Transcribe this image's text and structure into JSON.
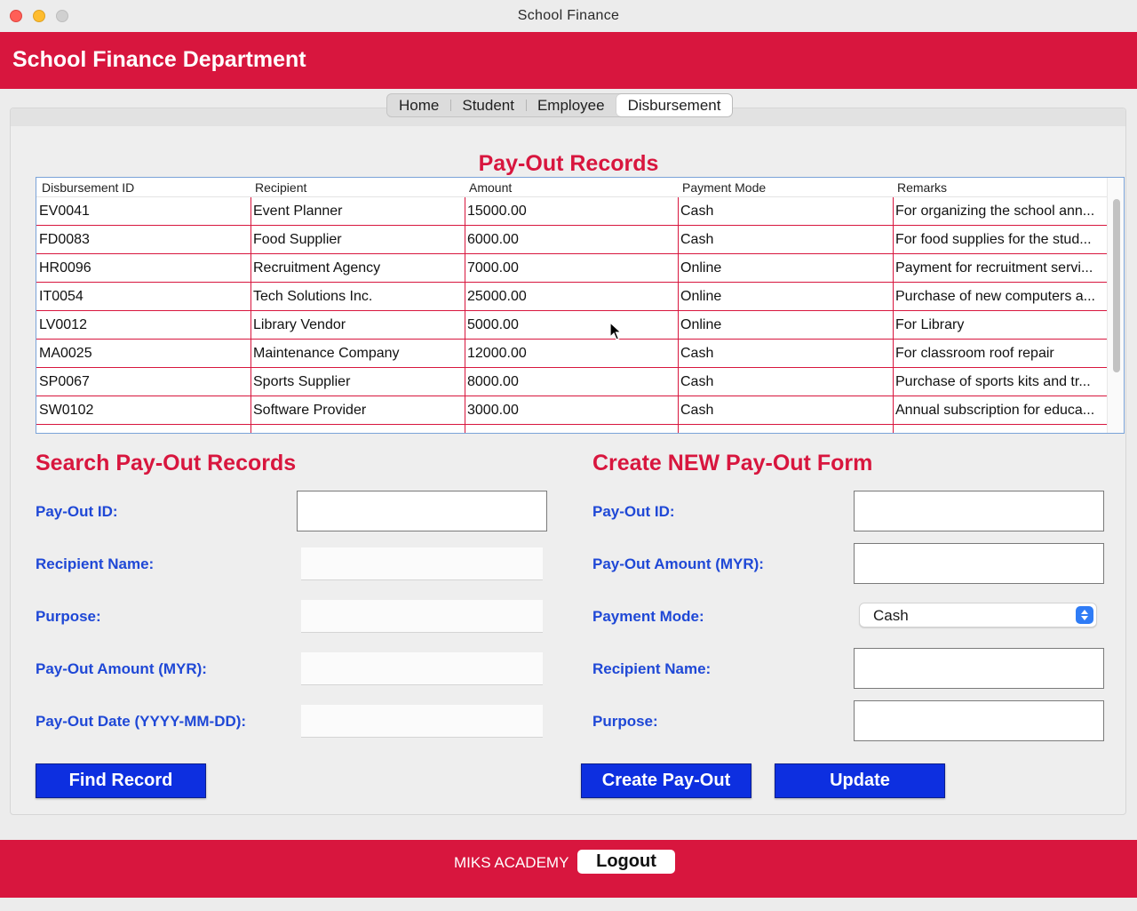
{
  "window": {
    "title": "School Finance"
  },
  "header": {
    "title": "School Finance Department"
  },
  "tabs": [
    {
      "label": "Home"
    },
    {
      "label": "Student"
    },
    {
      "label": "Employee"
    },
    {
      "label": "Disbursement",
      "active": true
    }
  ],
  "records": {
    "title": "Pay-Out Records",
    "columns": [
      "Disbursement ID",
      "Recipient",
      "Amount",
      "Payment Mode",
      "Remarks"
    ],
    "rows": [
      [
        "EV0041",
        "Event Planner",
        "15000.00",
        "Cash",
        "For organizing the school ann..."
      ],
      [
        "FD0083",
        "Food Supplier",
        "6000.00",
        "Cash",
        "For food supplies for the stud..."
      ],
      [
        "HR0096",
        "Recruitment Agency",
        "7000.00",
        "Online",
        "Payment for recruitment servi..."
      ],
      [
        "IT0054",
        "Tech Solutions Inc.",
        "25000.00",
        "Online",
        "Purchase of new computers a..."
      ],
      [
        "LV0012",
        "Library Vendor",
        "5000.00",
        "Online",
        "For Library"
      ],
      [
        "MA0025",
        "Maintenance Company",
        "12000.00",
        "Cash",
        "For classroom roof repair"
      ],
      [
        "SP0067",
        "Sports Supplier",
        "8000.00",
        "Cash",
        "Purchase of sports kits and tr..."
      ],
      [
        "SW0102",
        "Software Provider",
        "3000.00",
        "Cash",
        "Annual subscription for educa..."
      ]
    ]
  },
  "search": {
    "title": "Search Pay-Out Records",
    "payout_id_label": "Pay-Out ID:",
    "recipient_label": "Recipient Name:",
    "purpose_label": "Purpose:",
    "amount_label": "Pay-Out Amount (MYR):",
    "date_label": "Pay-Out Date (YYYY-MM-DD):",
    "payout_id_value": "",
    "recipient_value": "",
    "purpose_value": "",
    "amount_value": "",
    "date_value": "",
    "find_button": "Find Record"
  },
  "create": {
    "title": "Create NEW Pay-Out Form",
    "payout_id_label": "Pay-Out ID:",
    "amount_label": "Pay-Out Amount (MYR):",
    "mode_label": "Payment Mode:",
    "mode_value": "Cash",
    "recipient_label": "Recipient Name:",
    "purpose_label": "Purpose:",
    "payout_id_value": "",
    "amount_value": "",
    "recipient_value": "",
    "purpose_value": "",
    "create_button": "Create Pay-Out",
    "update_button": "Update"
  },
  "footer": {
    "academy": "MIKS ACADEMY",
    "logout": "Logout"
  },
  "colors": {
    "accent_red": "#d8163e",
    "label_blue": "#1f48d6",
    "button_blue": "#0d2fe0"
  }
}
